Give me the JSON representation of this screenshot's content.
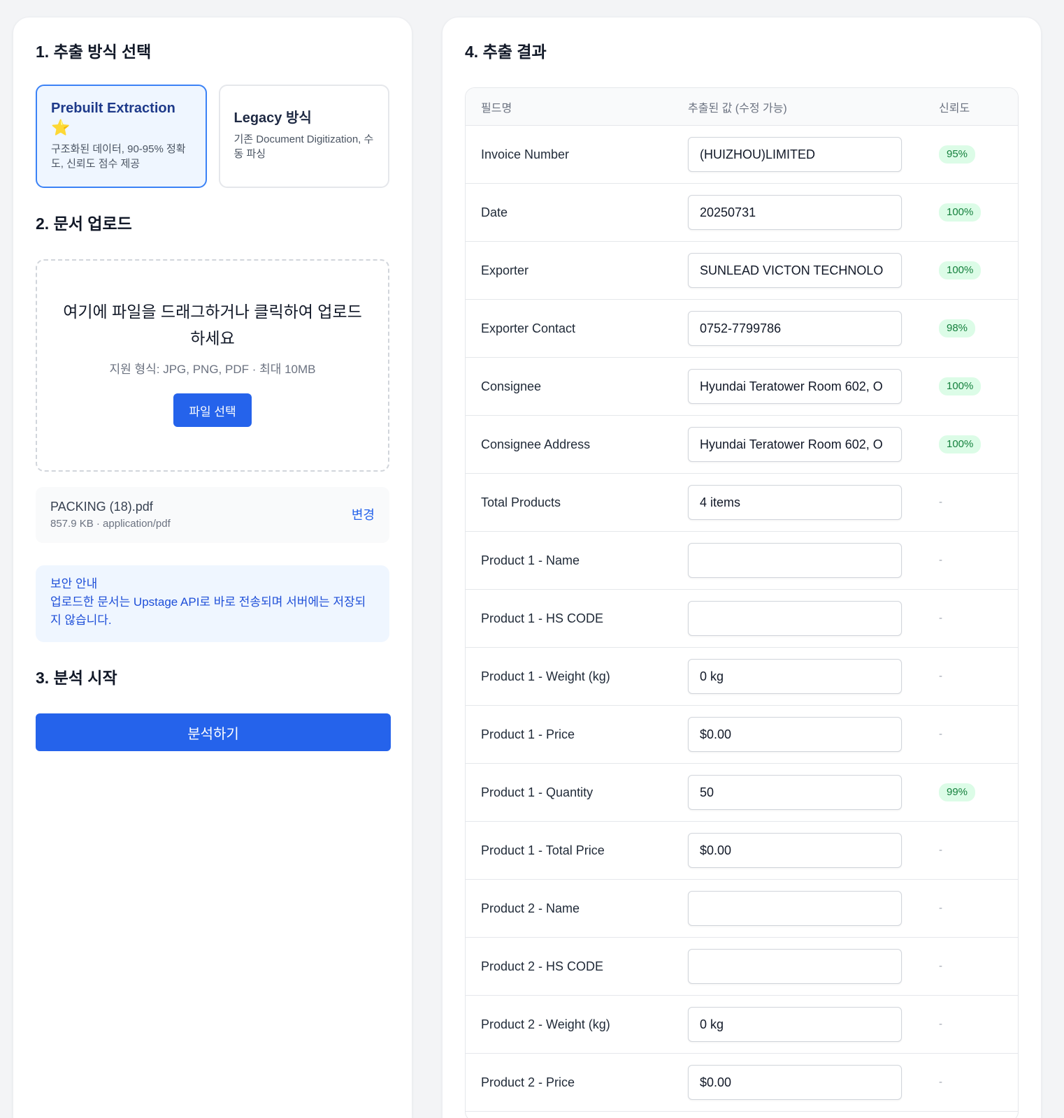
{
  "left": {
    "section1_title": "1. 추출 방식 선택",
    "methods": [
      {
        "title": "Prebuilt Extraction",
        "icon": "star-icon",
        "star": "⭐",
        "desc": "구조화된 데이터, 90-95% 정확도, 신뢰도 점수 제공",
        "selected": true
      },
      {
        "title": "Legacy 방식",
        "desc": "기존 Document Digitization, 수동 파싱",
        "selected": false
      }
    ],
    "section2_title": "2. 문서 업로드",
    "upload": {
      "main_text": "여기에 파일을 드래그하거나 클릭하여 업로드하세요",
      "hint": "지원 형식: JPG, PNG, PDF · 최대 10MB",
      "button_label": "파일 선택"
    },
    "file": {
      "name": "PACKING (18).pdf",
      "meta": "857.9 KB · application/pdf",
      "change_label": "변경"
    },
    "notice": {
      "title": "보안 안내",
      "body": "업로드한 문서는 Upstage API로 바로 전송되며 서버에는 저장되지 않습니다."
    },
    "section3_title": "3. 분석 시작",
    "analyze_label": "분석하기"
  },
  "right": {
    "section4_title": "4. 추출 결과",
    "headers": {
      "field": "필드명",
      "value": "추출된 값 (수정 가능)",
      "confidence": "신뢰도"
    },
    "rows": [
      {
        "field": "Invoice Number",
        "value": "(HUIZHOU)LIMITED",
        "confidence": "95%"
      },
      {
        "field": "Date",
        "value": "20250731",
        "confidence": "100%"
      },
      {
        "field": "Exporter",
        "value": "SUNLEAD VICTON TECHNOLO",
        "confidence": "100%"
      },
      {
        "field": "Exporter Contact",
        "value": "0752-7799786",
        "confidence": "98%"
      },
      {
        "field": "Consignee",
        "value": "Hyundai Teratower Room 602, O",
        "confidence": "100%"
      },
      {
        "field": "Consignee Address",
        "value": "Hyundai Teratower Room 602, O",
        "confidence": "100%"
      },
      {
        "field": "Total Products",
        "value": "4 items",
        "confidence": "-"
      },
      {
        "field": "Product 1 - Name",
        "value": "",
        "confidence": "-"
      },
      {
        "field": "Product 1 - HS CODE",
        "value": "",
        "confidence": "-"
      },
      {
        "field": "Product 1 - Weight (kg)",
        "value": "0 kg",
        "confidence": "-"
      },
      {
        "field": "Product 1 - Price",
        "value": "$0.00",
        "confidence": "-"
      },
      {
        "field": "Product 1 - Quantity",
        "value": "50",
        "confidence": "99%"
      },
      {
        "field": "Product 1 - Total Price",
        "value": "$0.00",
        "confidence": "-"
      },
      {
        "field": "Product 2 - Name",
        "value": "",
        "confidence": "-"
      },
      {
        "field": "Product 2 - HS CODE",
        "value": "",
        "confidence": "-"
      },
      {
        "field": "Product 2 - Weight (kg)",
        "value": "0 kg",
        "confidence": "-"
      },
      {
        "field": "Product 2 - Price",
        "value": "$0.00",
        "confidence": "-"
      }
    ]
  },
  "colors": {
    "primary": "#2563eb",
    "selected_border": "#3b82f6",
    "badge_bg": "#dcfce7",
    "badge_text": "#15803d"
  }
}
